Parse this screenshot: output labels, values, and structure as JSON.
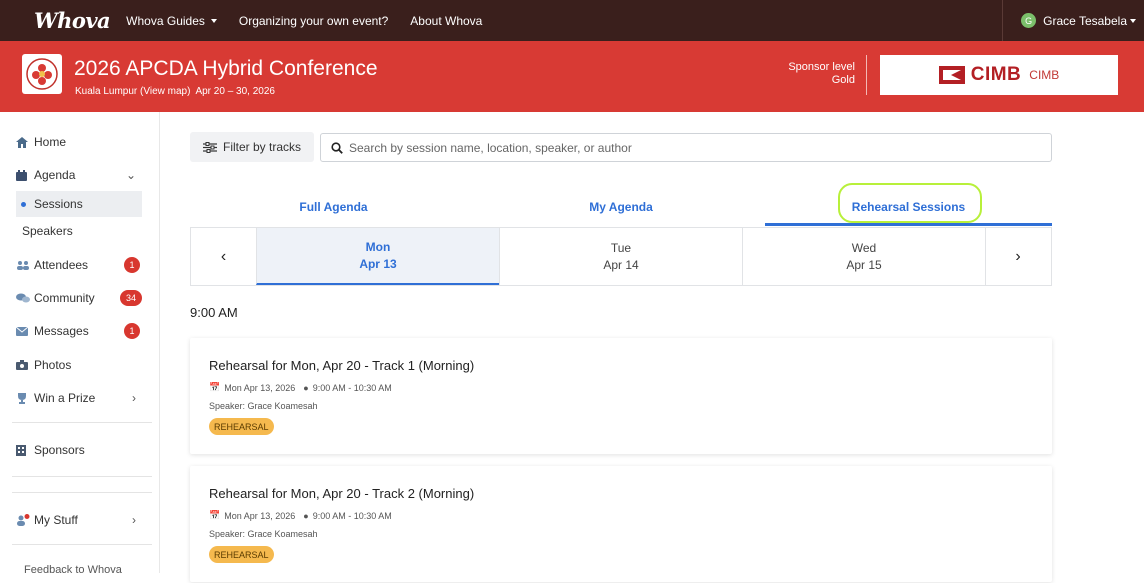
{
  "topnav": {
    "logo": "Whova",
    "links": [
      "Whova Guides",
      "Organizing your own event?",
      "About Whova"
    ],
    "user_initial": "G",
    "user_name": "Grace Tesabela"
  },
  "event": {
    "title": "2026 APCDA Hybrid Conference",
    "location": "Kuala Lumpur (View map)",
    "dates": "Apr 20 – 30, 2026",
    "sponsor_level_label": "Sponsor level",
    "sponsor_level_value": "Gold",
    "sponsor_logo_text": "CIMB",
    "sponsor_name": "CIMB"
  },
  "sidebar": {
    "home": "Home",
    "agenda": "Agenda",
    "sessions": "Sessions",
    "speakers": "Speakers",
    "attendees": "Attendees",
    "attendees_badge": "1",
    "community": "Community",
    "community_badge": "34",
    "messages": "Messages",
    "messages_badge": "1",
    "photos": "Photos",
    "win_prize": "Win a Prize",
    "sponsors": "Sponsors",
    "my_stuff": "My Stuff",
    "feedback": "Feedback to Whova"
  },
  "filter": {
    "label": "Filter by tracks",
    "search_placeholder": "Search by session name, location, speaker, or author"
  },
  "tabs": [
    "Full Agenda",
    "My Agenda",
    "Rehearsal Sessions"
  ],
  "days": [
    {
      "dow": "Mon",
      "date": "Apr 13"
    },
    {
      "dow": "Tue",
      "date": "Apr 14"
    },
    {
      "dow": "Wed",
      "date": "Apr 15"
    }
  ],
  "time_slot": "9:00 AM",
  "sessions": [
    {
      "title": "Rehearsal for Mon, Apr 20 - Track 1 (Morning)",
      "date": "Mon Apr 13, 2026",
      "time": "9:00 AM - 10:30 AM",
      "speaker": "Speaker: Grace Koamesah",
      "tag": "REHEARSAL"
    },
    {
      "title": "Rehearsal for Mon, Apr 20 - Track 2 (Morning)",
      "date": "Mon Apr 13, 2026",
      "time": "9:00 AM - 10:30 AM",
      "speaker": "Speaker: Grace Koamesah",
      "tag": "REHEARSAL"
    }
  ],
  "colors": {
    "topnav_bg": "#3a1f1c",
    "banner_bg": "#d83a34",
    "accent_blue": "#2f6fd6",
    "badge_red": "#d8372f",
    "tag_orange": "#f5b94e",
    "highlight_green": "#b8f03a"
  }
}
